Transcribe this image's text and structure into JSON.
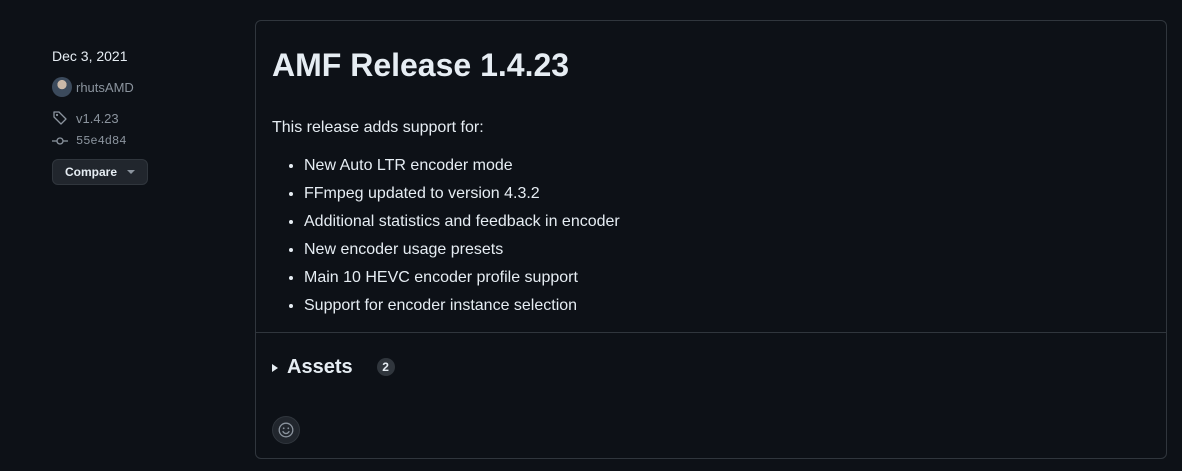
{
  "sidebar": {
    "date": "Dec 3, 2021",
    "author": "rhutsAMD",
    "tag": "v1.4.23",
    "commit": "55e4d84",
    "compare_label": "Compare"
  },
  "release": {
    "title": "AMF Release 1.4.23",
    "intro": "This release adds support for:",
    "features": [
      "New Auto LTR encoder mode",
      "FFmpeg updated to version 4.3.2",
      "Additional statistics and feedback in encoder",
      "New encoder usage presets",
      "Main 10 HEVC encoder profile support",
      "Support for encoder instance selection"
    ]
  },
  "assets": {
    "title": "Assets",
    "count": "2"
  },
  "icons": {
    "avatar": "avatar-icon",
    "tag": "tag-icon",
    "commit": "git-commit-icon",
    "dropdown": "triangle-down-icon",
    "disclosure": "triangle-right-icon",
    "reaction": "smiley-icon"
  },
  "colors": {
    "background": "#0d1117",
    "border": "#30363d",
    "text": "#e6edf3",
    "muted": "#8b949e"
  }
}
